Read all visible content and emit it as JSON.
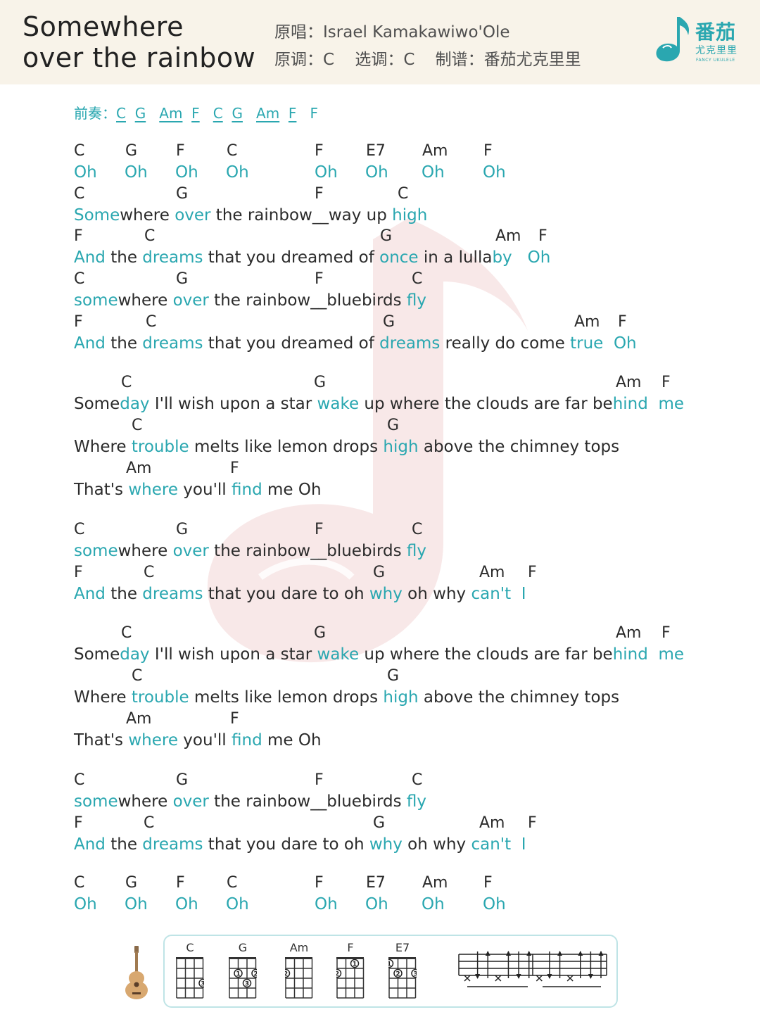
{
  "header": {
    "title_line1": "Somewhere",
    "title_line2": "over the rainbow",
    "singer_label": "原唱：",
    "singer": "Israel Kamakawiwo'Ole",
    "orig_key_label": "原调：",
    "orig_key": "C",
    "play_key_label": "选调：",
    "play_key": "C",
    "arranger_label": "制谱：",
    "arranger": "番茄尤克里里",
    "logo_cn": "番茄",
    "logo_sub": "尤克里里",
    "logo_en": "FANCY UKULELE"
  },
  "intro": {
    "label": "前奏：",
    "chords": [
      "C",
      "G",
      "Am",
      "F",
      "C",
      "G",
      "Am",
      "F",
      "F"
    ]
  },
  "chords": [
    [
      "C",
      "G",
      "F",
      "C",
      "F",
      "E7",
      "Am",
      "F"
    ],
    [
      "C",
      "G",
      "F",
      "C"
    ],
    [
      "F",
      "C",
      "G",
      "Am",
      "F"
    ],
    [
      "C",
      "G",
      "F",
      "C"
    ],
    [
      "F",
      "C",
      "G",
      "Am",
      "F"
    ],
    [
      "C",
      "G",
      "Am",
      "F"
    ],
    [
      "C",
      "G"
    ],
    [
      "Am",
      "F"
    ],
    [
      "C",
      "G",
      "F",
      "C"
    ],
    [
      "F",
      "C",
      "G",
      "Am",
      "F"
    ],
    [
      "C",
      "G",
      "Am",
      "F"
    ],
    [
      "C",
      "G"
    ],
    [
      "Am",
      "F"
    ],
    [
      "C",
      "G",
      "F",
      "C"
    ],
    [
      "F",
      "C",
      "G",
      "Am",
      "F"
    ],
    [
      "C",
      "G",
      "F",
      "C",
      "F",
      "E7",
      "Am",
      "F"
    ]
  ],
  "lyrics": [
    [
      [
        "Oh",
        1
      ],
      [
        "Oh",
        1
      ],
      [
        "Oh",
        1
      ],
      [
        "Oh",
        1
      ],
      [
        "Oh",
        1
      ],
      [
        "Oh",
        1
      ],
      [
        "Oh",
        1
      ],
      [
        "Oh",
        1
      ]
    ],
    [
      [
        "Some",
        1
      ],
      [
        "where ",
        0
      ],
      [
        "over",
        1
      ],
      [
        " the rainbow__way up ",
        0
      ],
      [
        "high",
        1
      ]
    ],
    [
      [
        "And",
        1
      ],
      [
        " the ",
        0
      ],
      [
        "dreams",
        1
      ],
      [
        " that you dreamed of ",
        0
      ],
      [
        "once",
        1
      ],
      [
        " in a lulla",
        0
      ],
      [
        "by",
        1
      ],
      [
        "   ",
        0
      ],
      [
        "Oh",
        1
      ]
    ],
    [
      [
        "some",
        1
      ],
      [
        "where ",
        0
      ],
      [
        "over",
        1
      ],
      [
        " the rainbow__bluebirds ",
        0
      ],
      [
        "fly",
        1
      ]
    ],
    [
      [
        "And",
        1
      ],
      [
        " the ",
        0
      ],
      [
        "dreams",
        1
      ],
      [
        " that you dreamed of ",
        0
      ],
      [
        "dreams",
        1
      ],
      [
        " really do come ",
        0
      ],
      [
        "true",
        1
      ],
      [
        "  ",
        0
      ],
      [
        "Oh",
        1
      ]
    ],
    [
      [
        "Some",
        0
      ],
      [
        "day",
        1
      ],
      [
        " I'll wish upon a star ",
        0
      ],
      [
        "wake",
        1
      ],
      [
        " up where the clouds are far be",
        0
      ],
      [
        "hind",
        1
      ],
      [
        "  ",
        0
      ],
      [
        "me",
        1
      ]
    ],
    [
      [
        "Where ",
        0
      ],
      [
        "trouble",
        1
      ],
      [
        " melts like lemon drops ",
        0
      ],
      [
        "high",
        1
      ],
      [
        " above the chimney tops",
        0
      ]
    ],
    [
      [
        "That's ",
        0
      ],
      [
        "where",
        1
      ],
      [
        " you'll ",
        0
      ],
      [
        "find",
        1
      ],
      [
        " me Oh",
        0
      ]
    ],
    [
      [
        "some",
        1
      ],
      [
        "where ",
        0
      ],
      [
        "over",
        1
      ],
      [
        " the rainbow__bluebirds ",
        0
      ],
      [
        "fly",
        1
      ]
    ],
    [
      [
        "And",
        1
      ],
      [
        " the ",
        0
      ],
      [
        "dreams",
        1
      ],
      [
        " that you dare to oh ",
        0
      ],
      [
        "why",
        1
      ],
      [
        " oh why ",
        0
      ],
      [
        "can't",
        1
      ],
      [
        "  ",
        0
      ],
      [
        "I",
        1
      ]
    ],
    [
      [
        "Some",
        0
      ],
      [
        "day",
        1
      ],
      [
        " I'll wish upon a star ",
        0
      ],
      [
        "wake",
        1
      ],
      [
        " up where the clouds are far be",
        0
      ],
      [
        "hind",
        1
      ],
      [
        "  ",
        0
      ],
      [
        "me",
        1
      ]
    ],
    [
      [
        "Where ",
        0
      ],
      [
        "trouble",
        1
      ],
      [
        " melts like lemon drops ",
        0
      ],
      [
        "high",
        1
      ],
      [
        " above the chimney tops",
        0
      ]
    ],
    [
      [
        "That's ",
        0
      ],
      [
        "where",
        1
      ],
      [
        " you'll ",
        0
      ],
      [
        "find",
        1
      ],
      [
        " me Oh",
        0
      ]
    ],
    [
      [
        "some",
        1
      ],
      [
        "where ",
        0
      ],
      [
        "over",
        1
      ],
      [
        " the rainbow__bluebirds ",
        0
      ],
      [
        "fly",
        1
      ]
    ],
    [
      [
        "And",
        1
      ],
      [
        " the ",
        0
      ],
      [
        "dreams",
        1
      ],
      [
        " that you dare to oh ",
        0
      ],
      [
        "why",
        1
      ],
      [
        " oh why ",
        0
      ],
      [
        "can't",
        1
      ],
      [
        "  ",
        0
      ],
      [
        "I",
        1
      ]
    ],
    [
      [
        "Oh",
        1
      ],
      [
        "Oh",
        1
      ],
      [
        "Oh",
        1
      ],
      [
        "Oh",
        1
      ],
      [
        "Oh",
        1
      ],
      [
        "Oh",
        1
      ],
      [
        "Oh",
        1
      ],
      [
        "Oh",
        1
      ]
    ]
  ],
  "chord_charts": [
    {
      "name": "C",
      "dots": [
        {
          "string": 4,
          "fret": 3,
          "finger": "3"
        }
      ]
    },
    {
      "name": "G",
      "dots": [
        {
          "string": 2,
          "fret": 2,
          "finger": "1"
        },
        {
          "string": 4,
          "fret": 2,
          "finger": "2"
        },
        {
          "string": 3,
          "fret": 3,
          "finger": "3"
        }
      ]
    },
    {
      "name": "Am",
      "dots": [
        {
          "string": 1,
          "fret": 2,
          "finger": "2"
        }
      ]
    },
    {
      "name": "F",
      "dots": [
        {
          "string": 3,
          "fret": 1,
          "finger": "1"
        },
        {
          "string": 1,
          "fret": 2,
          "finger": "2"
        }
      ]
    },
    {
      "name": "E7",
      "dots": [
        {
          "string": 1,
          "fret": 1,
          "finger": "1"
        },
        {
          "string": 2,
          "fret": 2,
          "finger": "2"
        },
        {
          "string": 4,
          "fret": 2,
          "finger": "3"
        }
      ]
    }
  ],
  "strum_pattern": [
    "x",
    "down",
    "up",
    "x",
    "up",
    "down",
    "up",
    "x",
    "down",
    "up",
    "x",
    "up",
    "down",
    "up"
  ],
  "colors": {
    "accent": "#2aa7b0",
    "text": "#2b2b2b",
    "header_bg": "#f8f3e9",
    "watermark": "#f0d8d8"
  }
}
